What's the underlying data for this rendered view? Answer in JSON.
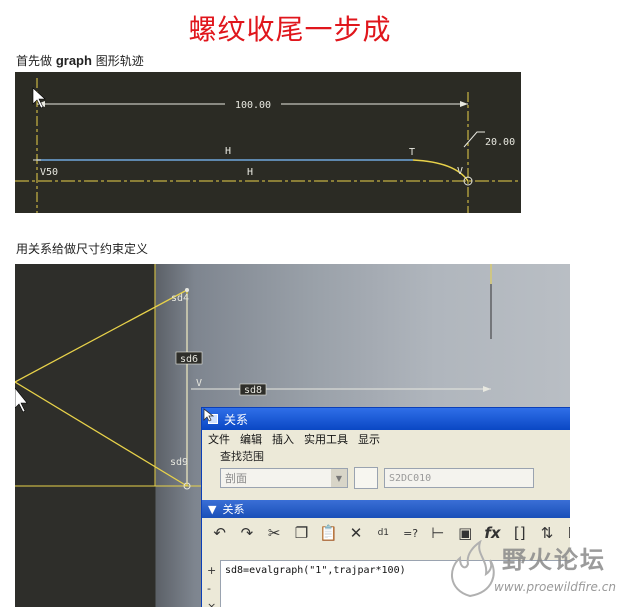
{
  "title": "螺纹收尾一步成",
  "caption1": {
    "prefix": "首先做 ",
    "bold": "graph",
    "suffix": " 图形轨迹"
  },
  "caption2": "用关系给做尺寸约束定义",
  "sketch1": {
    "dim_top": "100.00",
    "dim_right": "20.00",
    "label_h1": "H",
    "label_h2": "H",
    "label_t": "T",
    "label_v": "V",
    "label_v50": "V50"
  },
  "sketch2": {
    "dim_sd6": "sd6",
    "dim_sd8": "sd8",
    "label_sd4": "sd4",
    "label_sd9": "sd9",
    "label_v": "V"
  },
  "dialog": {
    "title": "关系",
    "menu": [
      "文件",
      "编辑",
      "插入",
      "实用工具",
      "显示"
    ],
    "scope_label": "查找范围",
    "scope_value": "剖面",
    "section_id": "S2DC010",
    "section_title": "关系",
    "gutter": [
      "+",
      "-",
      "×"
    ],
    "relation_code": "sd8=evalgraph(\"1\",trajpar*100)"
  },
  "watermark": {
    "cn": "野火论坛",
    "url": "www.proewildfire.cn"
  },
  "colors": {
    "title": "#e0161c",
    "sketch_bg": "#2b2b24",
    "yellow": "#e8d24a",
    "blue": "#6fa8dc",
    "dialog_title": "#0a47c4"
  }
}
